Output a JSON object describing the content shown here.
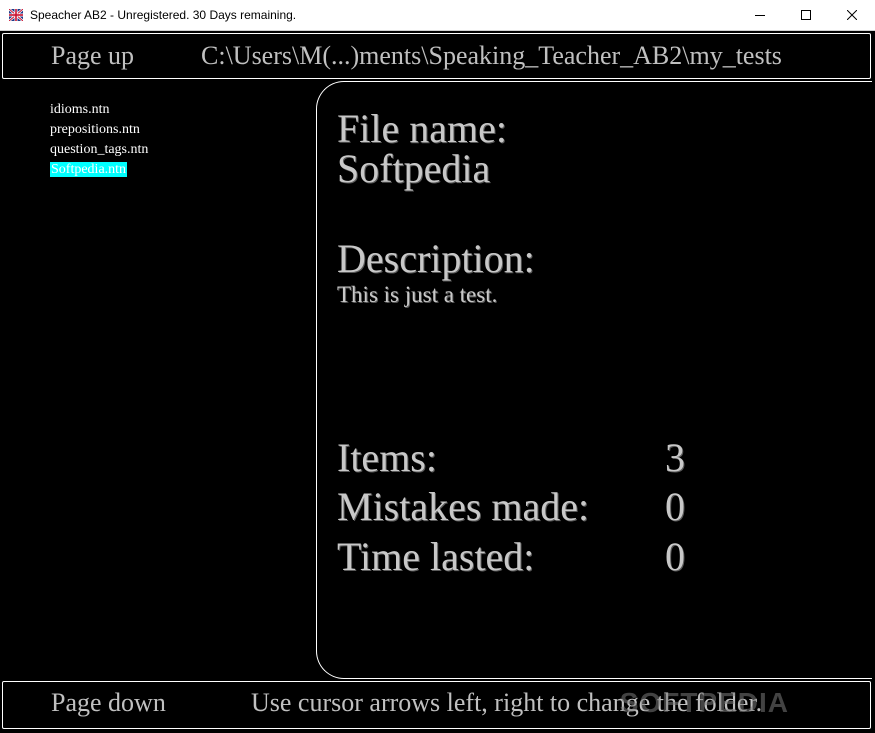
{
  "window": {
    "title": "Speacher AB2  - Unregistered. 30 Days remaining.",
    "app_icon": "uk-flag-icon",
    "controls": [
      "minimize-icon",
      "maximize-icon",
      "close-icon"
    ]
  },
  "topbar": {
    "page_up_label": "Page up",
    "path": "C:\\Users\\M(...)ments\\Speaking_Teacher_AB2\\my_tests"
  },
  "file_list": {
    "items": [
      {
        "name": "idioms.ntn",
        "selected": false
      },
      {
        "name": "prepositions.ntn",
        "selected": false
      },
      {
        "name": "question_tags.ntn",
        "selected": false
      },
      {
        "name": "Softpedia.ntn",
        "selected": true
      }
    ]
  },
  "info": {
    "file_name_label": "File name:",
    "file_name_value": "Softpedia",
    "description_label": "Description:",
    "description_value": "This is just a test.",
    "items_label": "Items:",
    "items_value": "3",
    "mistakes_label": "Mistakes made:",
    "mistakes_value": "0",
    "time_label": "Time lasted:",
    "time_value": "0"
  },
  "bottombar": {
    "page_down_label": "Page down",
    "hint": "Use cursor arrows left, right to change the folder."
  },
  "watermark": "SOFTPEDIA",
  "colors": {
    "background": "#000000",
    "text": "#c8c8c8",
    "selection": "#00ffff",
    "border": "#ffffff"
  }
}
